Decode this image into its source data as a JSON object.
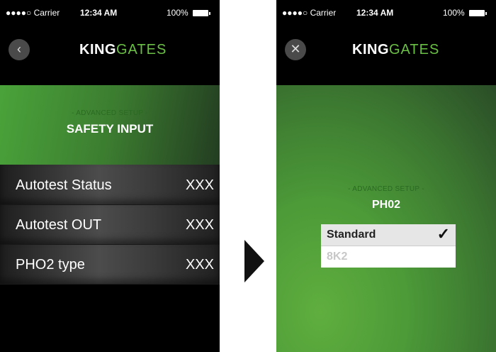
{
  "left_screen": {
    "statusbar": {
      "carrier": "●●●●○ Carrier ",
      "time": "12:34 AM",
      "battery": "100%"
    },
    "back_icon": "chevron-left-icon",
    "logo": {
      "part1": "KING",
      "part2": "GATES"
    },
    "header": {
      "subtitle": "- ADVANCED SETUP -",
      "title": "SAFETY INPUT"
    },
    "rows": [
      {
        "label": "Autotest Status",
        "value": "XXX"
      },
      {
        "label": "Autotest OUT",
        "value": "XXX"
      },
      {
        "label": "PHO2 type",
        "value": "XXX"
      }
    ]
  },
  "right_screen": {
    "statusbar": {
      "carrier": "●●●●○ Carrier ",
      "time": "12:34 AM",
      "battery": "100%"
    },
    "close_icon": "close-icon",
    "logo": {
      "part1": "KING",
      "part2": "GATES"
    },
    "header": {
      "subtitle": "- ADVANCED SETUP -",
      "title": "PH02"
    },
    "options": [
      {
        "label": "Standard",
        "selected": true
      },
      {
        "label": "8K2",
        "selected": false
      }
    ]
  },
  "colors": {
    "brand_green": "#6ac044",
    "panel_green": "#4aa33a",
    "background": "#000000"
  }
}
